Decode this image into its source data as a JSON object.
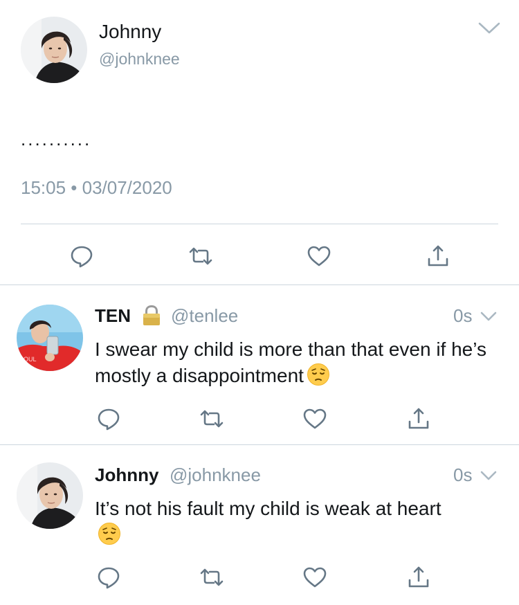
{
  "main_tweet": {
    "name": "Johnny",
    "handle": "@johnknee",
    "text": "..........",
    "timestamp": "15:05 • 03/07/2020"
  },
  "replies": [
    {
      "name": "TEN",
      "handle": "@tenlee",
      "time": "0s",
      "text": "I swear my child is more than that even if he’s mostly a disappointment",
      "protected": true
    },
    {
      "name": "Johnny",
      "handle": "@johnknee",
      "time": "0s",
      "text": "It’s not his fault my child is weak at heart",
      "protected": false
    }
  ],
  "icons": {
    "reply": "reply-icon",
    "retweet": "retweet-icon",
    "like": "like-icon",
    "share": "share-icon",
    "more": "chevron-down-icon",
    "lock": "lock-icon",
    "emoji": "pensive-face-emoji"
  },
  "colors": {
    "text_primary": "#14171a",
    "text_secondary": "#8899a6",
    "icon": "#657786",
    "divider": "#ccd6dd"
  }
}
